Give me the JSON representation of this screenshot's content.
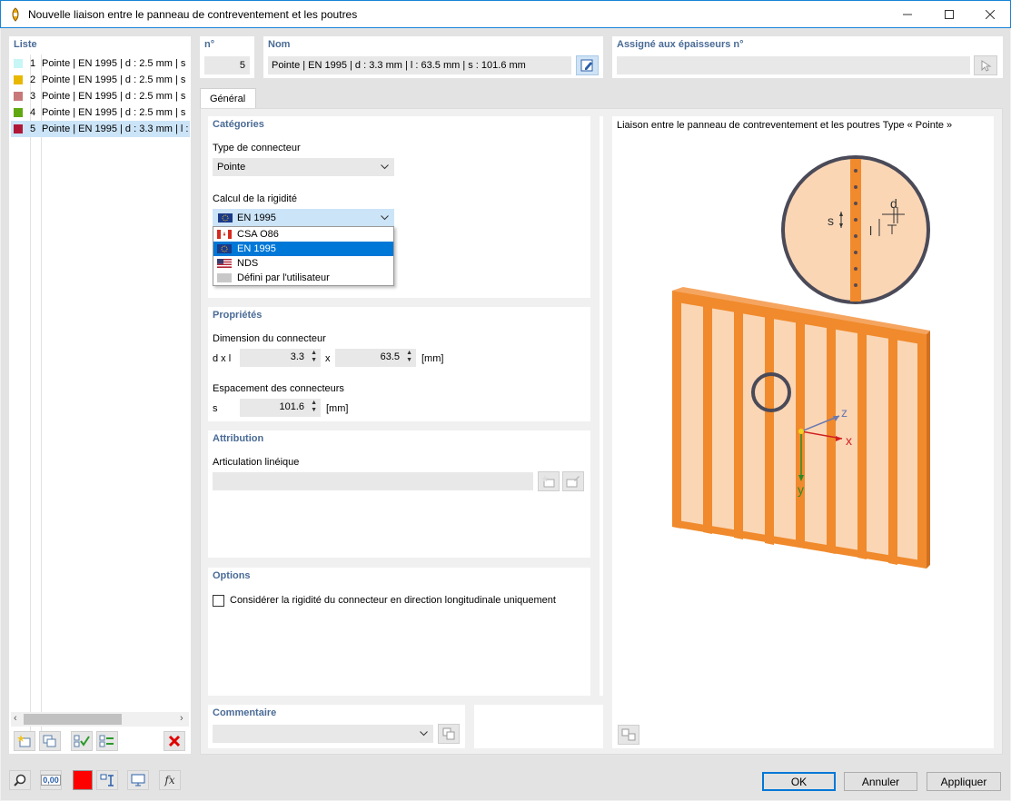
{
  "window": {
    "title": "Nouvelle liaison entre le panneau de contreventement et les poutres"
  },
  "list": {
    "header": "Liste",
    "items": [
      {
        "num": "1",
        "label": "Pointe | EN 1995 | d : 2.5 mm | s",
        "color": "#c8f6f6"
      },
      {
        "num": "2",
        "label": "Pointe | EN 1995 | d : 2.5 mm | s",
        "color": "#e8b800"
      },
      {
        "num": "3",
        "label": "Pointe | EN 1995 | d : 2.5 mm | s",
        "color": "#c87878"
      },
      {
        "num": "4",
        "label": "Pointe | EN 1995 | d : 2.5 mm | s",
        "color": "#60a810"
      },
      {
        "num": "5",
        "label": "Pointe | EN 1995 | d : 3.3 mm | l :",
        "color": "#b01838"
      }
    ],
    "selected_index": 4
  },
  "header": {
    "num_label": "n°",
    "num_value": "5",
    "name_label": "Nom",
    "name_value": "Pointe | EN 1995 | d : 3.3 mm | l : 63.5 mm | s : 101.6 mm",
    "assigned_label": "Assigné aux épaisseurs n°",
    "assigned_value": ""
  },
  "tabs": [
    {
      "label": "Général",
      "active": true
    }
  ],
  "categories": {
    "title": "Catégories",
    "connector_type_label": "Type de connecteur",
    "connector_type_value": "Pointe",
    "stiffness_label": "Calcul de la rigidité",
    "stiffness_value": "EN 1995",
    "stiffness_options": [
      {
        "label": "CSA O86",
        "flag": "ca"
      },
      {
        "label": "EN 1995",
        "flag": "eu",
        "selected": true
      },
      {
        "label": "NDS",
        "flag": "us"
      },
      {
        "label": "Défini par l'utilisateur",
        "flag": "none"
      }
    ]
  },
  "properties": {
    "title": "Propriétés",
    "dimension_label": "Dimension du connecteur",
    "dxl_label": "d x l",
    "d_value": "3.3",
    "x_sep": "x",
    "l_value": "63.5",
    "unit_mm": "[mm]",
    "spacing_label": "Espacement des connecteurs",
    "s_label": "s",
    "s_value": "101.6"
  },
  "attribution": {
    "title": "Attribution",
    "line_hinge_label": "Articulation linéique",
    "line_hinge_value": ""
  },
  "options": {
    "title": "Options",
    "checkbox_label": "Considérer la rigidité du connecteur en direction longitudinale uniquement",
    "checked": false
  },
  "comment": {
    "title": "Commentaire",
    "value": ""
  },
  "figure": {
    "caption": "Liaison entre le panneau de contreventement et les poutres Type « Pointe »",
    "labels": {
      "s": "s",
      "d": "d",
      "l": "l",
      "x": "x",
      "y": "y",
      "z": "z"
    }
  },
  "footer": {
    "ok": "OK",
    "cancel": "Annuler",
    "apply": "Appliquer",
    "units_icon_text": "0,00"
  },
  "colors": {
    "accent": "#0078d7",
    "section_title": "#4a6b96",
    "selection": "#cce4f7",
    "timber": "#f08a2c",
    "timber_light": "#fbd6b5",
    "close_red": "#e81123"
  }
}
